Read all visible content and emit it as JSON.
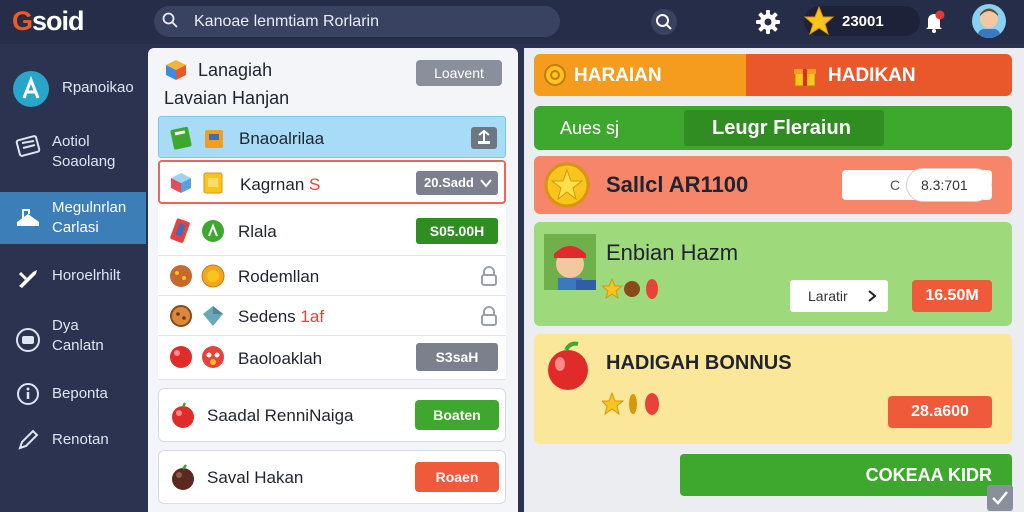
{
  "app": {
    "logo_text": "soid",
    "logo_initial": "G"
  },
  "search": {
    "value": "Kanoae lenmtiam Rorlarin"
  },
  "topbar": {
    "coins": "23001",
    "icons": [
      "search-icon",
      "gear-icon",
      "star-icon",
      "notification-icon",
      "avatar"
    ]
  },
  "sidebar": {
    "items": [
      {
        "label": "Rpanoikao",
        "icon": "profile-icon"
      },
      {
        "label": "Aotiol\nSoaolang",
        "icon": "list-icon"
      },
      {
        "label": "Megulnrlan\nCarlasi",
        "icon": "cart-icon",
        "active": true
      },
      {
        "label": "Horoelrhilt",
        "icon": "wrench-icon"
      },
      {
        "label": "Dya\nCanlatn",
        "icon": "settings-icon"
      },
      {
        "label": "Beponta",
        "icon": "info-icon"
      },
      {
        "label": "Renotan",
        "icon": "pencil-icon"
      }
    ]
  },
  "middle": {
    "title": "Lanagiah",
    "subtitle": "Lavaian Hanjan",
    "header_button": "Loavent",
    "rows": [
      {
        "label": "Bnaoalrilaa",
        "right": "",
        "right_icon": "share-icon"
      },
      {
        "label": "Kagrnan",
        "label_accent": "S",
        "right": "20.Sadd",
        "right_icon": "chevron-down-icon"
      },
      {
        "label": "Rlala",
        "right": "S05.00H"
      },
      {
        "label": "Rodemllan",
        "right_icon": "lock-icon"
      },
      {
        "label": "Sedens",
        "label_accent": "1af",
        "right_icon": "lock-icon"
      },
      {
        "label": "Baoloaklah",
        "right": "S3saH"
      }
    ],
    "card1": {
      "label": "Saadal RenniNaiga",
      "button": "Boaten"
    },
    "card2": {
      "label": "Saval Hakan",
      "button": "Roaen"
    }
  },
  "right": {
    "tabs": [
      {
        "label": "HARAIAN"
      },
      {
        "label": "HADIKAN"
      }
    ],
    "green_bar": {
      "left": "Aues sj",
      "right": "Leugr Fleraiun"
    },
    "banner1": {
      "title": "Sallcl AR1100",
      "field_prefix": "C",
      "field_value": "8.3:701"
    },
    "banner2": {
      "title": "Enbian Hazm",
      "select": "Laratir",
      "button": "16.50M"
    },
    "banner3": {
      "title": "HADIGAH BONNUS",
      "button": "28.a600"
    },
    "cta": {
      "label": "COKEAA KIDR"
    }
  },
  "colors": {
    "accent_blue": "#3c7fb8",
    "tab_orange": "#f59b1e",
    "tab_red": "#e8582a",
    "green": "#3ea82e",
    "salmon": "#f7856a",
    "light_green": "#9ed97c",
    "light_yellow": "#fbe79a",
    "button_red": "#ee5a3a"
  }
}
